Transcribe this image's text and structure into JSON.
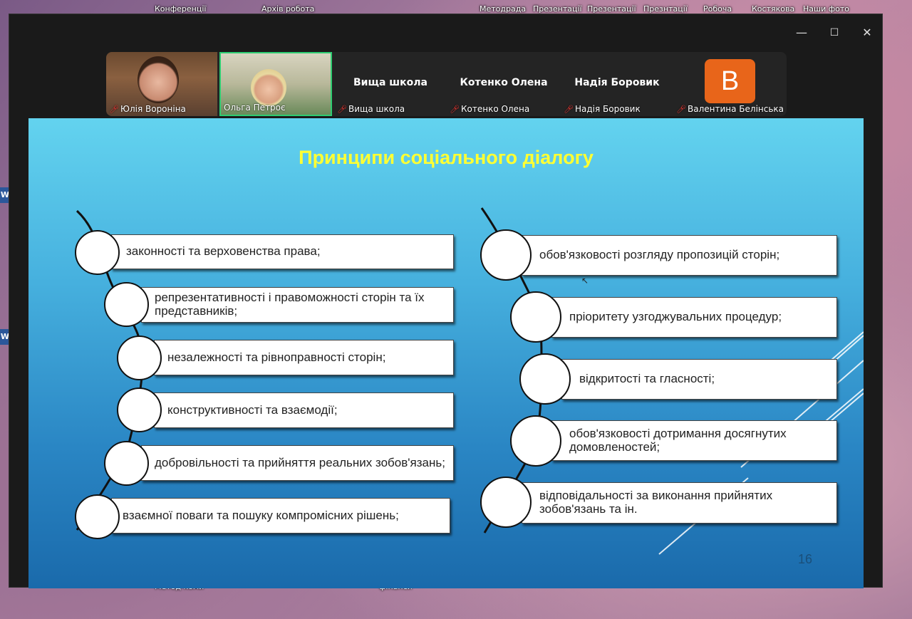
{
  "desktop": {
    "top_icons": [
      "Конференції",
      "Архів робота",
      "Методрада",
      "Презентації",
      "Презентації",
      "Презнтації",
      "Робоча",
      "Костякова",
      "Наши фото"
    ],
    "bottom_icons": [
      "Метод коми",
      "фінанси"
    ]
  },
  "window": {
    "controls": {
      "minimize": "—",
      "maximize": "☐",
      "close": "✕"
    }
  },
  "participants": [
    {
      "name": "Юлія Вороніна",
      "muted": true
    },
    {
      "name": "Ольга Петроє",
      "muted": false
    },
    {
      "name": "Вища школа",
      "muted": true
    },
    {
      "name": "Котенко Олена",
      "muted": true
    },
    {
      "name": "Надія Боровик",
      "muted": true
    },
    {
      "name": "Валентина Белінська",
      "muted": true,
      "avatar_letter": "B",
      "avatar_color": "#e8651a"
    }
  ],
  "slide": {
    "title": "Принципи соціального діалогу",
    "page_number": "16",
    "left_items": [
      "законності та верховенства права;",
      "репрезентативності  і правоможності сторін та їх представників;",
      "незалежності та рівноправності сторін;",
      "конструктивності та взаємодії;",
      "добровільності та прийняття  реальних зобов'язань;",
      "взаємної поваги та пошуку компромісних рішень;"
    ],
    "right_items": [
      "обов'язковості розгляду пропозицій сторін;",
      "пріоритету  узгоджувальних процедур;",
      "відкритості та гласності;",
      "обов'язковості дотримання  досягнутих домовленостей;",
      "відповідальності за виконання прийнятих зобов'язань та ін."
    ],
    "colors": {
      "title": "#ffff33",
      "background_top": "#63d3ef",
      "background_bottom": "#1a6aab"
    }
  }
}
